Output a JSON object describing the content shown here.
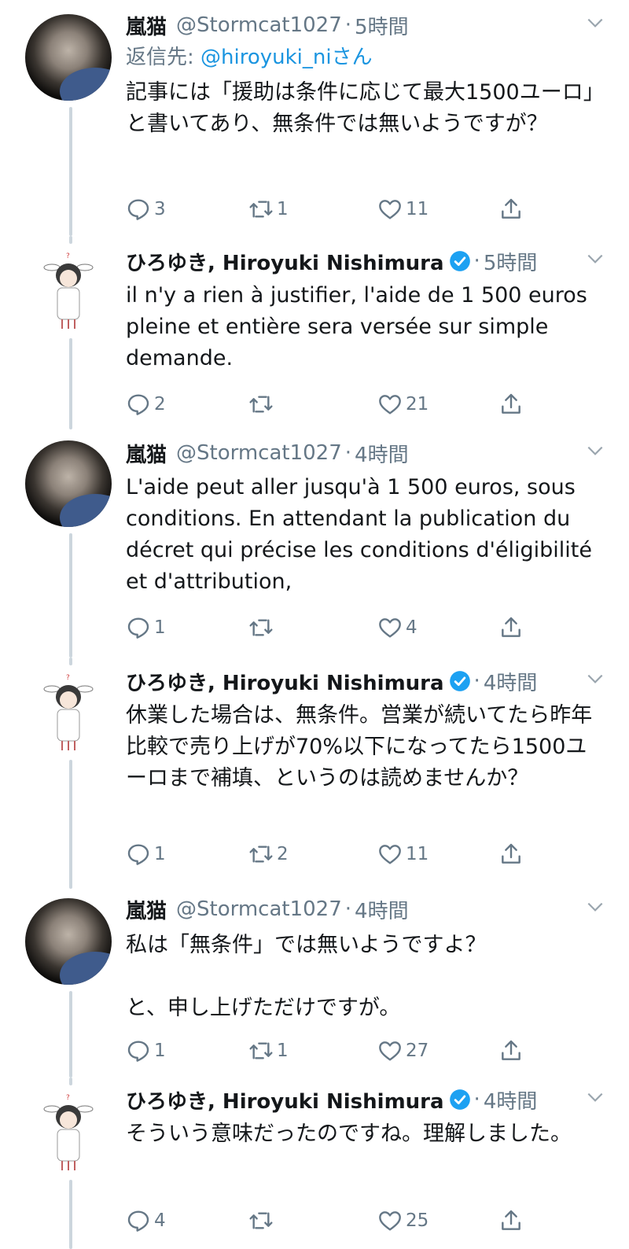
{
  "colors": {
    "text": "#14171a",
    "secondary": "#657786",
    "link": "#1b95e0",
    "verified": "#1da1f2",
    "thread_line": "#ccd6dd"
  },
  "tweets": [
    {
      "name": "嵐猫",
      "handle": "@Stormcat1027",
      "sep": "·",
      "time": "5時間",
      "reply_label": "返信先:",
      "reply_mention": "@hiroyuki_ni",
      "reply_suffix": "さん",
      "text": "記事には「援助は条件に応じて最大1500ユーロ」と書いてあり、無条件では無いようですが？",
      "reply_count": "3",
      "retweet_count": "1",
      "like_count": "11",
      "avatar": "cat-avatar",
      "verified": false
    },
    {
      "name": "ひろゆき, Hiroyuki Nishimura",
      "handle": "",
      "sep": "·",
      "time": "5時間",
      "text": "il n'y a rien à justifier, l'aide de 1 500 euros pleine et entière sera versée sur simple demande.",
      "reply_count": "2",
      "retweet_count": "",
      "like_count": "21",
      "avatar": "anime-avatar",
      "verified": true
    },
    {
      "name": "嵐猫",
      "handle": "@Stormcat1027",
      "sep": "·",
      "time": "4時間",
      "text": "L'aide peut aller jusqu'à 1 500 euros, sous conditions. En attendant la publication du décret qui précise les conditions d'éligibilité et d'attribution,",
      "reply_count": "1",
      "retweet_count": "",
      "like_count": "4",
      "avatar": "cat-avatar",
      "verified": false
    },
    {
      "name": "ひろゆき, Hiroyuki Nishimura",
      "handle": "",
      "sep": "·",
      "time": "4時間",
      "text": "休業した場合は、無条件。営業が続いてたら昨年比較で売り上げが70%以下になってたら1500ユーロまで補填、というのは読めませんか？",
      "reply_count": "1",
      "retweet_count": "2",
      "like_count": "11",
      "avatar": "anime-avatar",
      "verified": true
    },
    {
      "name": "嵐猫",
      "handle": "@Stormcat1027",
      "sep": "·",
      "time": "4時間",
      "text": "私は「無条件」では無いようですよ？\n\nと、申し上げただけですが。",
      "reply_count": "1",
      "retweet_count": "1",
      "like_count": "27",
      "avatar": "cat-avatar",
      "verified": false
    },
    {
      "name": "ひろゆき, Hiroyuki Nishimura",
      "handle": "",
      "sep": "·",
      "time": "4時間",
      "text": "そういう意味だったのですね。理解しました。",
      "reply_count": "4",
      "retweet_count": "",
      "like_count": "25",
      "avatar": "anime-avatar",
      "verified": true
    }
  ],
  "icons": {
    "reply": "reply-icon",
    "retweet": "retweet-icon",
    "like": "heart-icon",
    "share": "share-icon",
    "caret": "chevron-down-icon",
    "verified": "verified-badge-icon"
  }
}
